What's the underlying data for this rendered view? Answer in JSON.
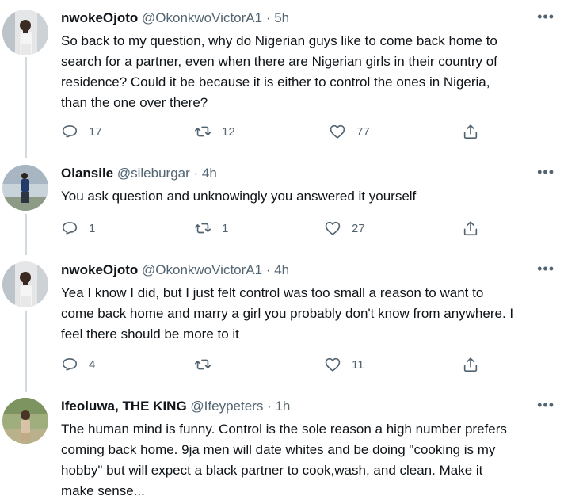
{
  "tweets": [
    {
      "name": "nwokeOjoto",
      "handle": "@OkonkwoVictorA1",
      "separator": "·",
      "time": "5h",
      "text_lines": [
        "So back to my question, why do Nigerian guys like to come back home to",
        "search for a partner, even when there are Nigerian girls in their country of",
        "residence? Could it be because it is either to control the ones in Nigeria,",
        "than the one over there?"
      ],
      "replies": "17",
      "retweets": "12",
      "likes": "77"
    },
    {
      "name": "Olansile",
      "handle": "@sileburgar",
      "separator": "·",
      "time": "4h",
      "text_lines": [
        "You ask question and unknowingly you answered it yourself"
      ],
      "replies": "1",
      "retweets": "1",
      "likes": "27"
    },
    {
      "name": "nwokeOjoto",
      "handle": "@OkonkwoVictorA1",
      "separator": "·",
      "time": "4h",
      "text_lines": [
        "Yea I know I did, but I just felt control was too small a reason to want to",
        "come back home and marry a girl you probably don't know from anywhere. I",
        "feel there should be more to it"
      ],
      "replies": "4",
      "retweets": "",
      "likes": "11"
    },
    {
      "name": "Ifeoluwa, THE KING",
      "handle": "@Ifeypeters",
      "separator": "·",
      "time": "1h",
      "text_lines": [
        "The human mind is funny. Control is the sole reason a high number prefers",
        "coming back home. 9ja men will date whites and be doing \"cooking is my",
        "hobby\" but will expect a black partner to cook,wash, and clean. Make it",
        "make sense..."
      ]
    }
  ],
  "icons": {
    "more": "more-horizontal-icon",
    "reply": "reply-icon",
    "retweet": "retweet-icon",
    "like": "like-icon",
    "share": "share-icon"
  },
  "colors": {
    "text": "#0f1419",
    "secondary": "#536471",
    "thread_line": "#cfd9de"
  }
}
